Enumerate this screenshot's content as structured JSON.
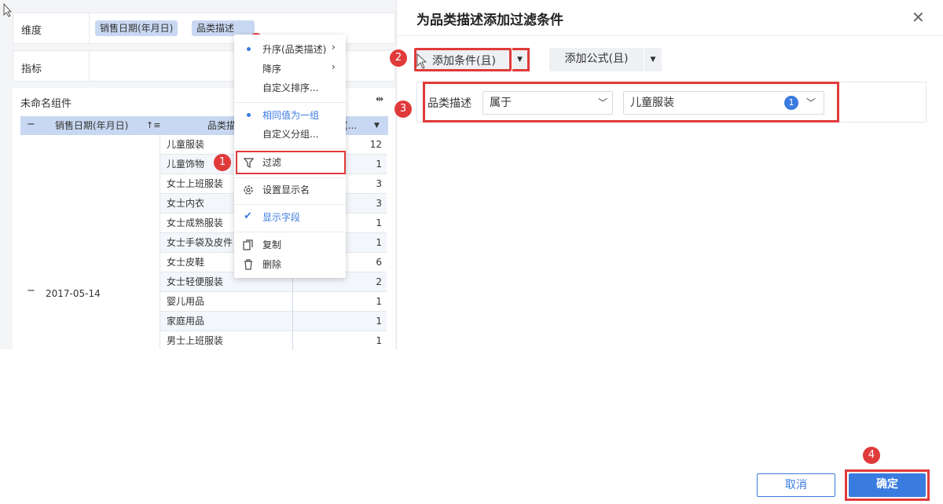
{
  "left": {
    "dimension_label": "维度",
    "measure_label": "指标",
    "chips": [
      "销售日期(年月日)",
      "品类描述"
    ],
    "component_title": "未命名组件",
    "table": {
      "header_date": "销售日期(年月日)",
      "header_category": "品类描",
      "header_value": "(...",
      "date_value": "2017-05-14",
      "rows": [
        {
          "name": "儿童服装",
          "value": "12"
        },
        {
          "name": "儿童饰物",
          "value": "1"
        },
        {
          "name": "女士上班服装",
          "value": "3"
        },
        {
          "name": "女士内衣",
          "value": "3"
        },
        {
          "name": "女士成熟服装",
          "value": "1"
        },
        {
          "name": "女士手袋及皮件",
          "value": "1"
        },
        {
          "name": "女士皮鞋",
          "value": "6"
        },
        {
          "name": "女士轻便服装",
          "value": "2"
        },
        {
          "name": "婴儿用品",
          "value": "1"
        },
        {
          "name": "家庭用品",
          "value": "1"
        },
        {
          "name": "男士上班服装",
          "value": "1"
        }
      ]
    }
  },
  "menu": {
    "items": [
      "升序(品类描述)",
      "降序",
      "自定义排序...",
      "相同值为一组",
      "自定义分组...",
      "过滤",
      "设置显示名",
      "显示字段",
      "复制",
      "删除"
    ]
  },
  "dialog": {
    "title": "为品类描述添加过滤条件",
    "add_condition": "添加条件(且)",
    "add_formula": "添加公式(且)",
    "field": "品类描述",
    "operator": "属于",
    "value": "儿童服装",
    "value_count": "1",
    "cancel": "取消",
    "confirm": "确定"
  },
  "badges": [
    "1",
    "2",
    "3",
    "4"
  ],
  "colors": {
    "accent": "#3a7be0",
    "annotation": "#e03a3a",
    "chip": "#c9d8f2"
  }
}
